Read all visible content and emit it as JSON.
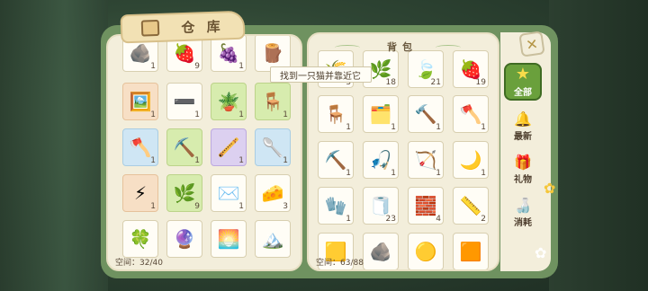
{
  "warehouse": {
    "title": "仓 库",
    "space": "空间：32/40",
    "top_row": [
      {
        "icon": "🪨",
        "count": "1"
      },
      {
        "icon": "🍓",
        "count": "9"
      },
      {
        "icon": "🍇",
        "count": "1"
      },
      {
        "icon": "🪵",
        "count": ""
      }
    ],
    "rows": [
      [
        {
          "icon": "🖼️",
          "count": "1",
          "bg": "orange"
        },
        {
          "icon": "➖",
          "count": "1",
          "bg": ""
        },
        {
          "icon": "🪴",
          "count": "1",
          "bg": "green"
        },
        {
          "icon": "🪑",
          "count": "1",
          "bg": "green"
        }
      ],
      [
        {
          "icon": "🪓",
          "count": "1",
          "bg": "blue"
        },
        {
          "icon": "⛏️",
          "count": "1",
          "bg": "green"
        },
        {
          "icon": "🪈",
          "count": "1",
          "bg": "purple"
        },
        {
          "icon": "🥄",
          "count": "1",
          "bg": "blue"
        }
      ],
      [
        {
          "icon": "⚡",
          "count": "1",
          "bg": "orange"
        },
        {
          "icon": "🌿",
          "count": "9",
          "bg": "green"
        },
        {
          "icon": "✉️",
          "count": "1",
          "bg": ""
        },
        {
          "icon": "🧀",
          "count": "3",
          "bg": ""
        }
      ],
      [
        {
          "icon": "🍀",
          "count": "",
          "bg": ""
        },
        {
          "icon": "🔮",
          "count": "",
          "bg": ""
        },
        {
          "icon": "🌅",
          "count": "",
          "bg": ""
        },
        {
          "icon": "🏔️",
          "count": "",
          "bg": ""
        }
      ]
    ]
  },
  "backpack": {
    "title": "背包",
    "space": "空间：63/88",
    "top_row": [
      {
        "icon": "🌾",
        "count": "3"
      },
      {
        "icon": "🌿",
        "count": "18"
      },
      {
        "icon": "🍃",
        "count": "21"
      },
      {
        "icon": "🍓",
        "count": "19"
      }
    ],
    "rows": [
      [
        {
          "icon": "🪑",
          "count": "1"
        },
        {
          "icon": "🗂️",
          "count": "1"
        },
        {
          "icon": "🔨",
          "count": "1"
        },
        {
          "icon": "🪓",
          "count": "1"
        }
      ],
      [
        {
          "icon": "⛏️",
          "count": "1"
        },
        {
          "icon": "🎣",
          "count": "1"
        },
        {
          "icon": "🏹",
          "count": "1"
        },
        {
          "icon": "🌙",
          "count": "1"
        }
      ],
      [
        {
          "icon": "🧤",
          "count": "1"
        },
        {
          "icon": "🧻",
          "count": "23"
        },
        {
          "icon": "🧱",
          "count": "4"
        },
        {
          "icon": "📏",
          "count": "2"
        }
      ],
      [
        {
          "icon": "🟨",
          "count": ""
        },
        {
          "icon": "🪨",
          "count": ""
        },
        {
          "icon": "🟡",
          "count": ""
        },
        {
          "icon": "🟧",
          "count": ""
        }
      ]
    ]
  },
  "tooltip": "找到一只猫并靠近它",
  "side_tabs": [
    {
      "label": "全部",
      "icon": "★"
    },
    {
      "label": "最新",
      "icon": "🔔"
    },
    {
      "label": "礼物",
      "icon": "🎁"
    },
    {
      "label": "消耗",
      "icon": "🍶"
    }
  ],
  "close_icon": "✕"
}
